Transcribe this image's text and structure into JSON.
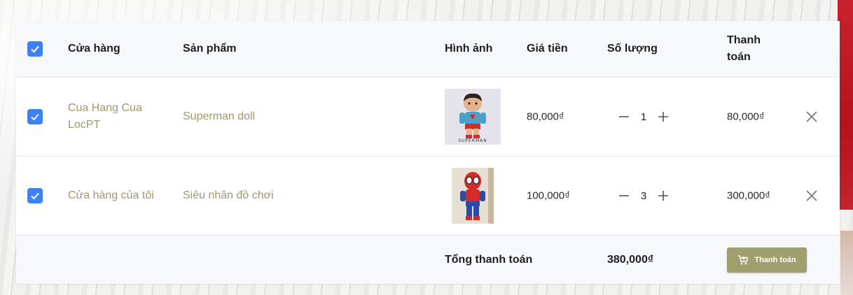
{
  "header": {
    "store": "Cửa hàng",
    "product": "Sản phẩm",
    "image": "Hình ảnh",
    "price": "Giá tiền",
    "quantity": "Số lượng",
    "payment_line1": "Thanh",
    "payment_line2": "toán"
  },
  "items": [
    {
      "checked": true,
      "store_line1": "Cua Hang Cua",
      "store_line2": "LocPT",
      "product": "Superman doll",
      "image_icon": "superman-doll-image",
      "image_caption": "SUPERMAN",
      "price": "80,000₫",
      "quantity": "1",
      "subtotal": "80,000₫"
    },
    {
      "checked": true,
      "store": "Cửa hàng của tôi",
      "product": "Siêu nhân đồ chơi",
      "image_icon": "spiderman-toy-image",
      "price": "100,000₫",
      "quantity": "3",
      "subtotal": "300,000₫"
    }
  ],
  "footer": {
    "total_label": "Tổng thanh toán",
    "total_value": "380,000₫",
    "checkout_label": "Thanh toán",
    "checkout_icon": "cart-icon"
  },
  "colors": {
    "accent": "#3b82f6",
    "muted_text": "#9b9a6e",
    "button": "#a09f6e"
  }
}
